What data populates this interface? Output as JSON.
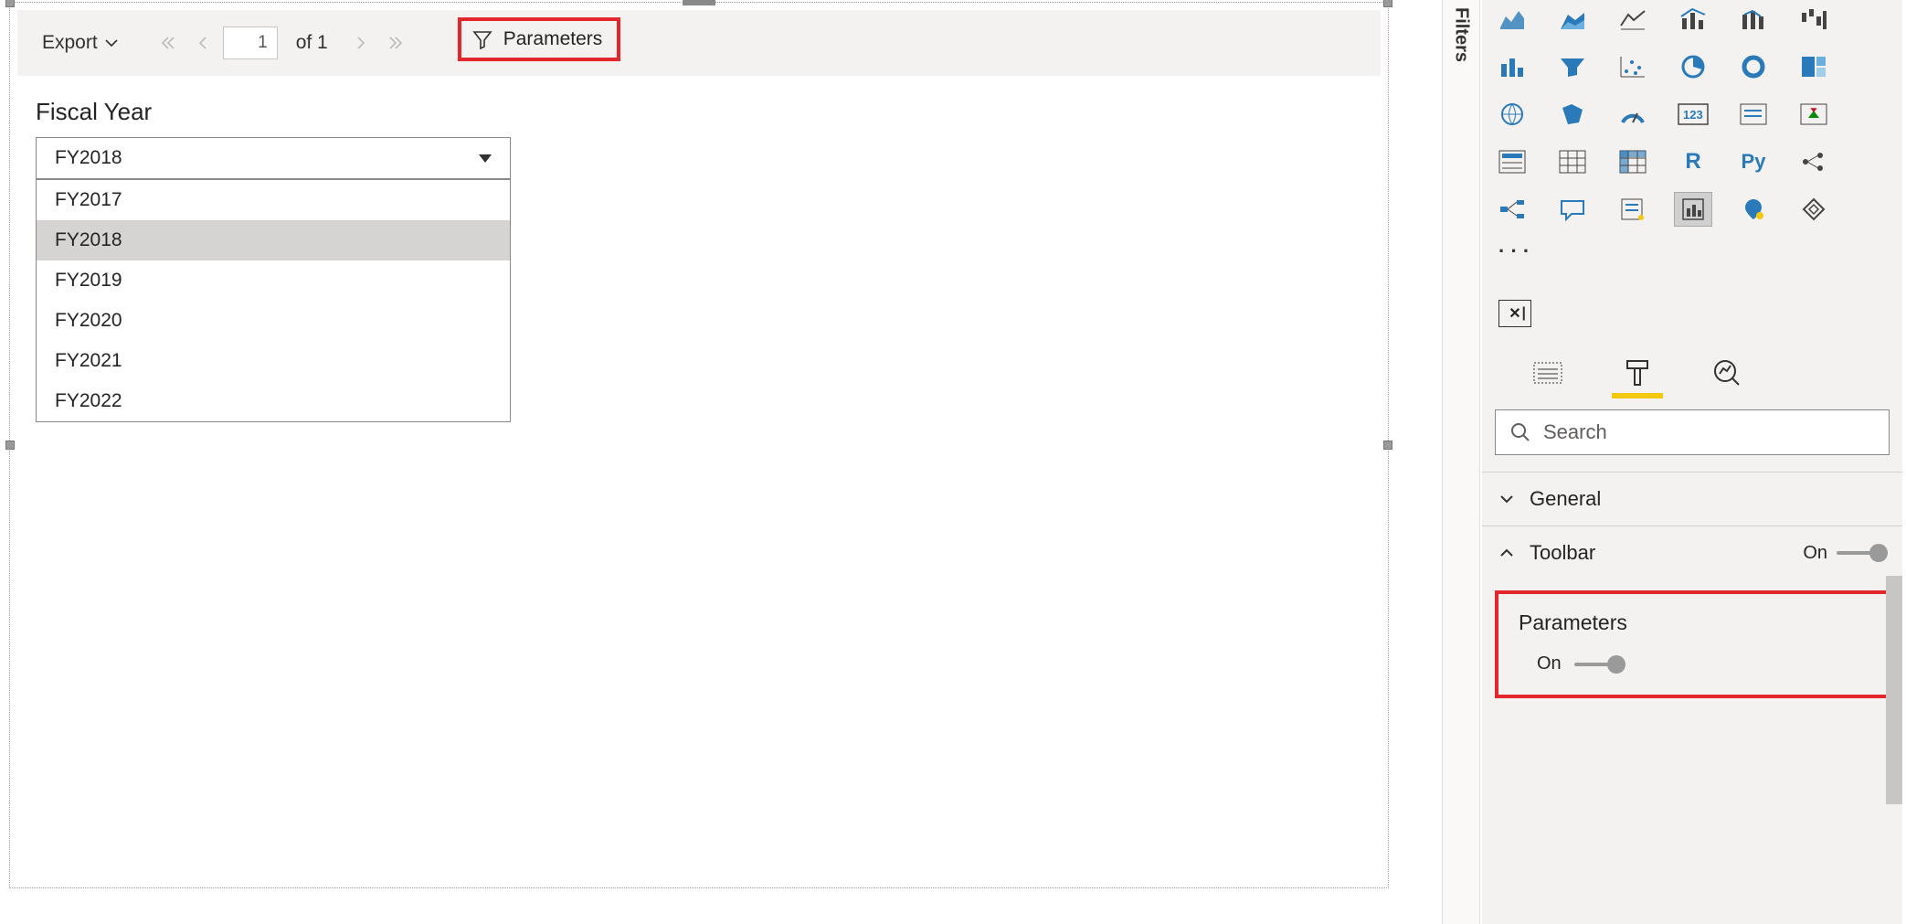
{
  "toolbar": {
    "export_label": "Export",
    "page_current": "1",
    "page_total_label": "of 1",
    "parameters_label": "Parameters"
  },
  "report": {
    "parameter_title": "Fiscal Year",
    "selected_value": "FY2018",
    "options": [
      "FY2017",
      "FY2018",
      "FY2019",
      "FY2020",
      "FY2021",
      "FY2022"
    ]
  },
  "filters_tab_label": "Filters",
  "viz_icons": [
    "area-chart",
    "stacked-area",
    "line-column",
    "combo-chart",
    "ribbon",
    "waterfall",
    "bar-chart",
    "funnel",
    "scatter",
    "pie",
    "donut",
    "treemap",
    "map",
    "filled-map",
    "gauge",
    "card",
    "multi-row-card",
    "kpi",
    "slicer",
    "table",
    "matrix",
    "r-visual",
    "py-visual",
    "key-influencers",
    "decomposition",
    "q-and-a",
    "narrative",
    "paginated",
    "arcgis",
    "powerapps"
  ],
  "format_pane": {
    "search_placeholder": "Search",
    "sections": {
      "general_label": "General",
      "toolbar_label": "Toolbar",
      "toolbar_state": "On",
      "parameters_label": "Parameters",
      "parameters_state": "On"
    }
  }
}
